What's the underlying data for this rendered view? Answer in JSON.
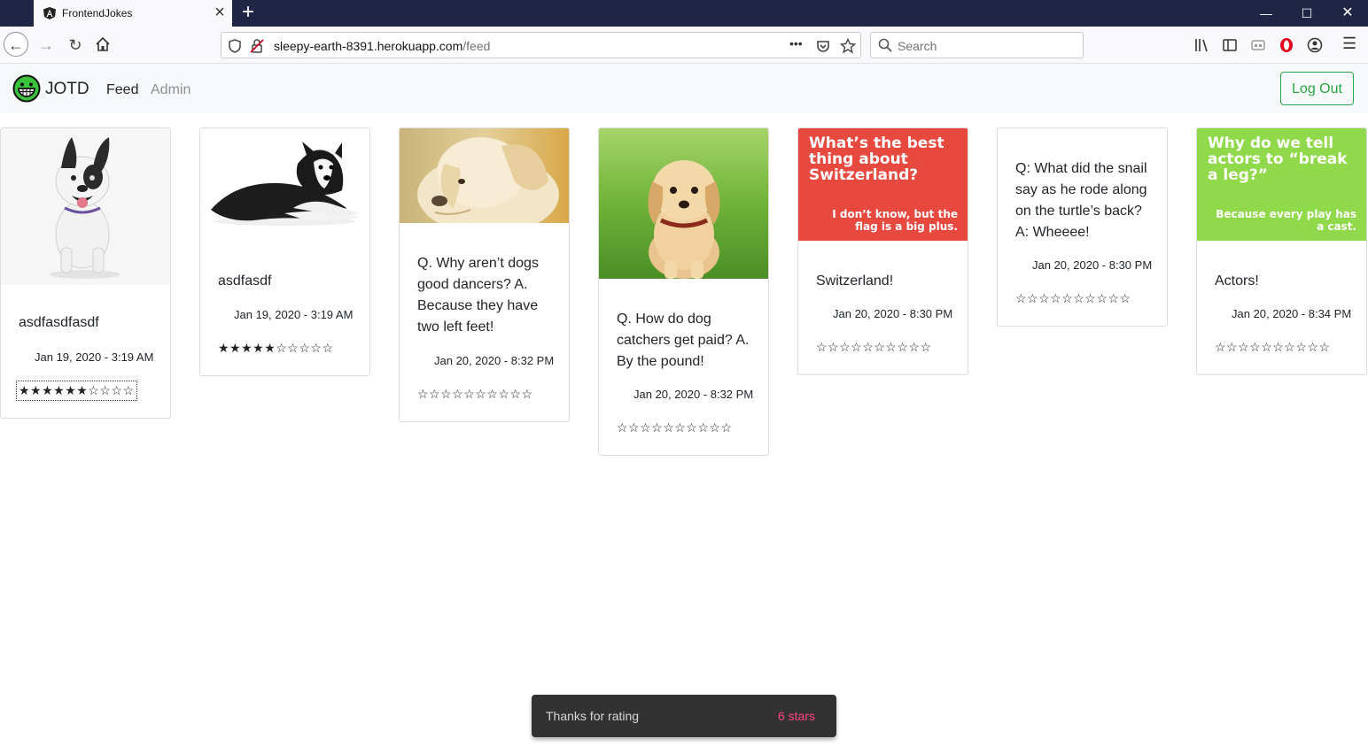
{
  "browser": {
    "tab_title": "FrontendJokes",
    "url_domain": "sleepy-earth-8391.herokuapp.com",
    "url_path": "/feed",
    "search_placeholder": "Search",
    "page_actions": "•••"
  },
  "navbar": {
    "brand": "JOTD",
    "feed": "Feed",
    "admin": "Admin",
    "logout": "Log Out"
  },
  "cards": [
    {
      "text": "asdfasdfasdf",
      "date": "Jan 19, 2020 - 3:19 AM",
      "stars": "★★★★★★☆☆☆☆",
      "rating": 6,
      "image": "french-bulldog-photo"
    },
    {
      "text": "asdfasdf",
      "date": "Jan 19, 2020 - 3:19 AM",
      "stars": "★★★★★☆☆☆☆☆",
      "rating": 5,
      "image": "border-collie-puppy-photo"
    },
    {
      "text": "Q. Why aren’t dogs good dancers? A. Because they have two left feet!",
      "date": "Jan 20, 2020 - 8:32 PM",
      "stars": "☆☆☆☆☆☆☆☆☆☆",
      "rating": 0,
      "image": "labrador-puppy-photo"
    },
    {
      "text": "Q. How do dog catchers get paid? A. By the pound!",
      "date": "Jan 20, 2020 - 8:32 PM",
      "stars": "☆☆☆☆☆☆☆☆☆☆",
      "rating": 0,
      "image": "golden-puppy-grass-photo"
    },
    {
      "text": "Switzerland!",
      "date": "Jan 20, 2020 - 8:30 PM",
      "stars": "☆☆☆☆☆☆☆☆☆☆",
      "rating": 0,
      "sign": {
        "question": "What’s the best thing about Switzerland?",
        "answer": "I don’t know, but the flag is a big plus.",
        "color": "#e8493f"
      }
    },
    {
      "text": "Q: What did the snail say as he rode along on the turtle’s back? A: Wheeee!",
      "date": "Jan 20, 2020 - 8:30 PM",
      "stars": "☆☆☆☆☆☆☆☆☆☆",
      "rating": 0
    },
    {
      "text": "Actors!",
      "date": "Jan 20, 2020 - 8:34 PM",
      "stars": "☆☆☆☆☆☆☆☆☆☆",
      "rating": 0,
      "sign": {
        "question": "Why do we tell actors to “break a leg?”",
        "answer": "Because every play has a cast.",
        "color": "#8fd94a"
      }
    }
  ],
  "snackbar": {
    "message": "Thanks for rating",
    "action": "6 stars"
  }
}
